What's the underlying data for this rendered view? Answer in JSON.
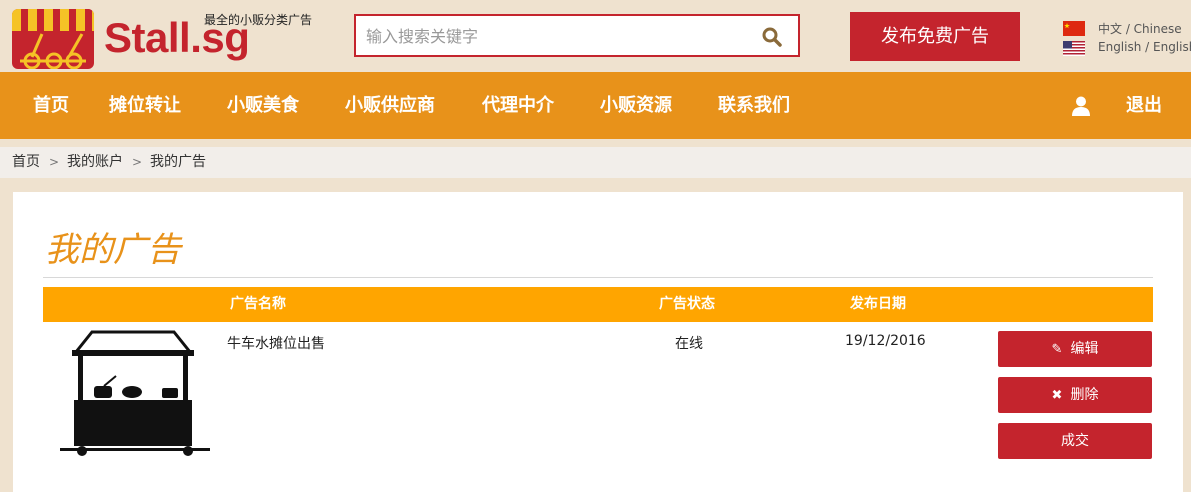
{
  "header": {
    "logo_text": "Stall.sg",
    "tagline": "最全的小贩分类广告",
    "search_placeholder": "输入搜索关键字",
    "post_ad_label": "发布免费广告",
    "languages": [
      {
        "label": "中文 / Chinese",
        "icon": "china-flag-icon"
      },
      {
        "label": "English / English",
        "icon": "us-flag-icon"
      }
    ]
  },
  "nav": {
    "items": [
      "首页",
      "摊位转让",
      "小贩美食",
      "小贩供应商",
      "代理中介",
      "小贩资源",
      "联系我们"
    ],
    "logout_label": "退出"
  },
  "breadcrumb": [
    "首页",
    "我的账户",
    "我的广告"
  ],
  "page": {
    "title": "我的广告",
    "table": {
      "headers": [
        "广告名称",
        "广告状态",
        "发布日期"
      ],
      "rows": [
        {
          "name": "牛车水摊位出售",
          "status": "在线",
          "date": "19/12/2016",
          "actions": [
            "编辑",
            "删除",
            "成交"
          ]
        }
      ]
    }
  },
  "colors": {
    "brand_red": "#c4242d",
    "nav_orange": "#e8921a",
    "table_header": "#ffa500"
  }
}
